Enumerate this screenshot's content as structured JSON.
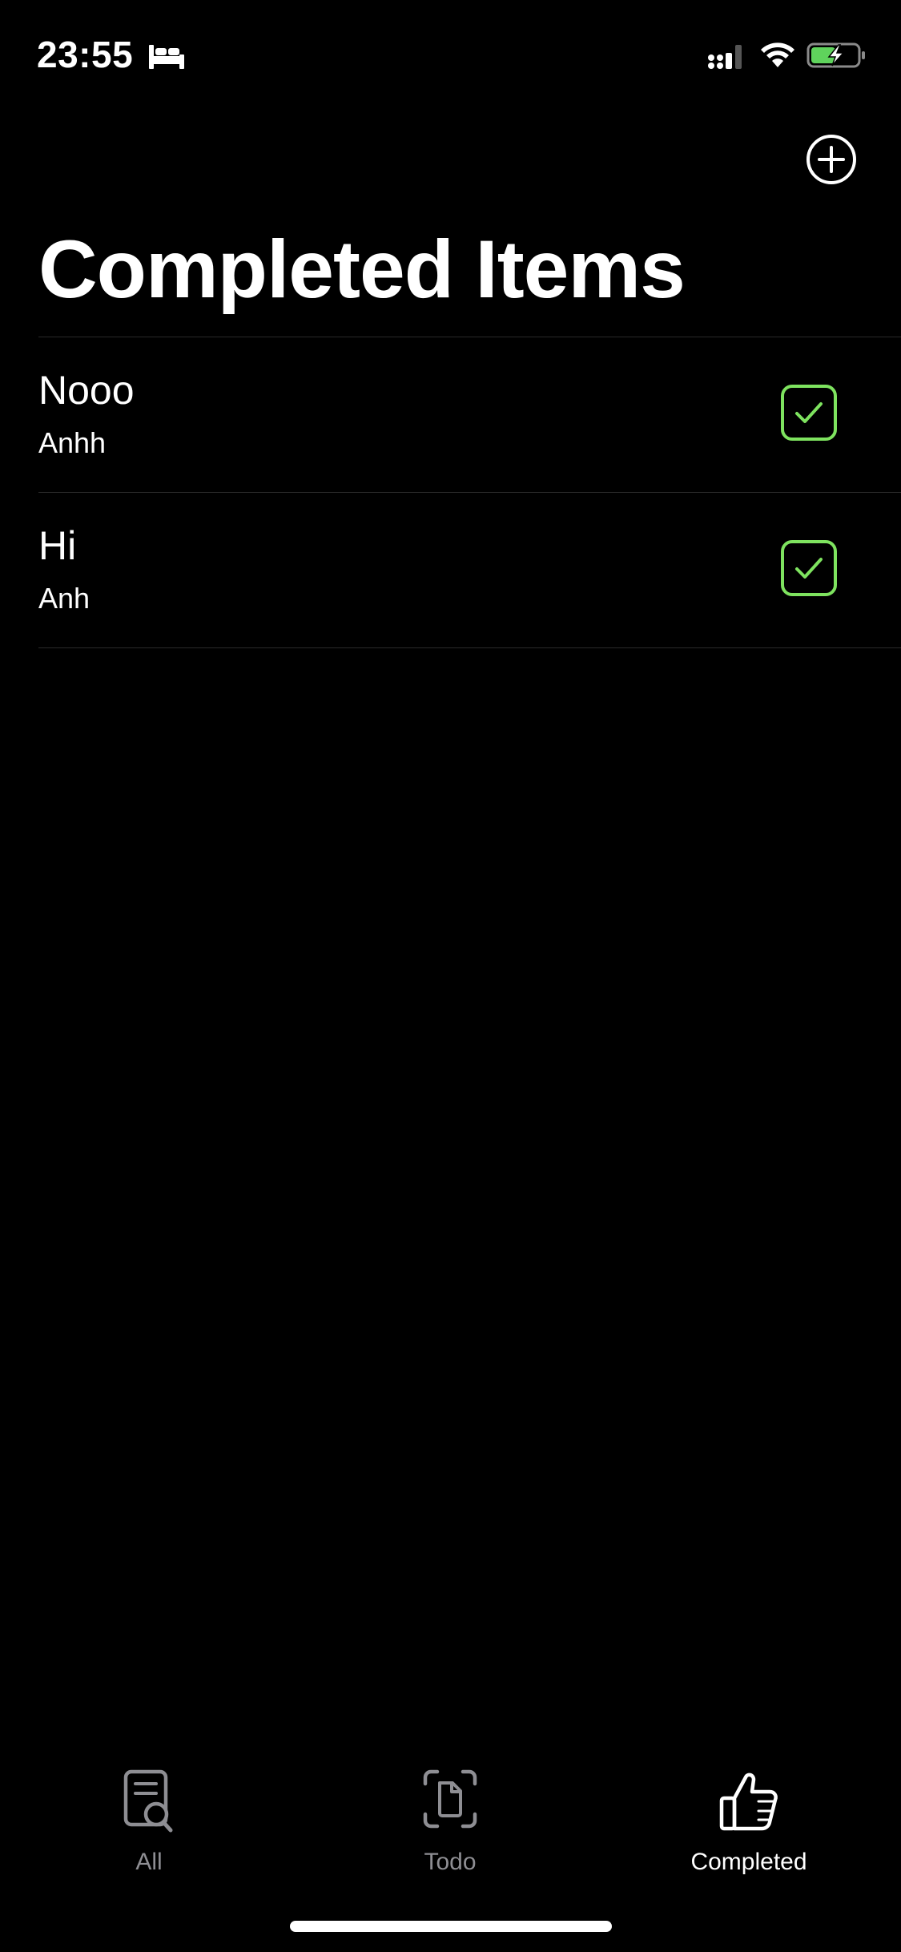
{
  "status_bar": {
    "time": "23:55",
    "icons": [
      "bed-icon",
      "cellular-signal-icon",
      "wifi-icon",
      "battery-charging-icon"
    ]
  },
  "nav": {
    "add_icon": "plus-circle-icon"
  },
  "page": {
    "title": "Completed Items"
  },
  "items": [
    {
      "title": "Nooo",
      "subtitle": "Anhh",
      "completed": true
    },
    {
      "title": "Hi",
      "subtitle": "Anh",
      "completed": true
    }
  ],
  "tabs": [
    {
      "label": "All",
      "icon": "document-search-icon",
      "active": false
    },
    {
      "label": "Todo",
      "icon": "document-scan-icon",
      "active": false
    },
    {
      "label": "Completed",
      "icon": "thumbs-up-icon",
      "active": true
    }
  ],
  "colors": {
    "background": "#000000",
    "check_accent": "#7ee35f",
    "inactive_tab": "#8e8e93",
    "battery_fill": "#5fd35c"
  }
}
